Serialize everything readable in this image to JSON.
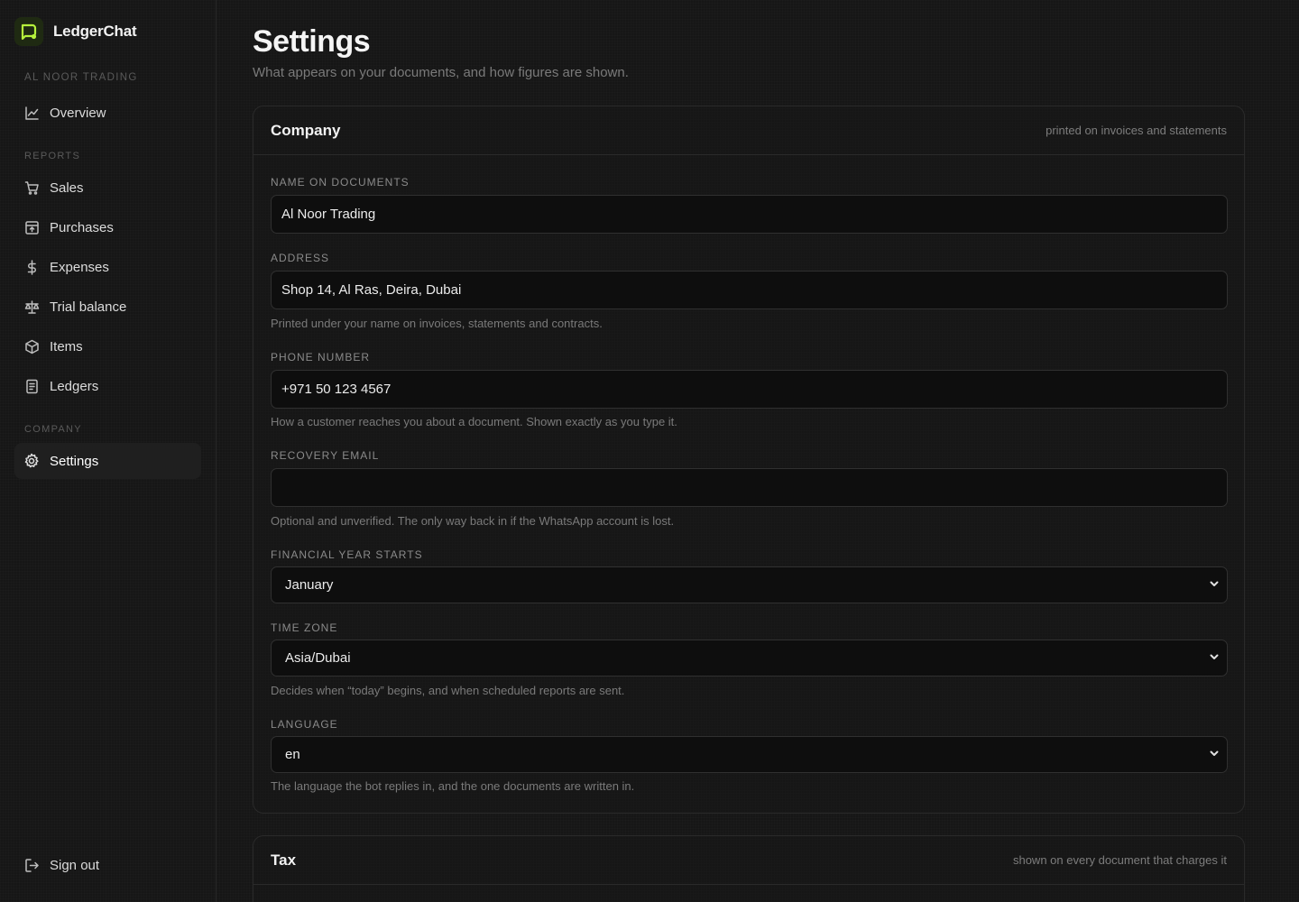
{
  "brand": {
    "name": "LedgerChat",
    "accent": "#b6f23c"
  },
  "sidebar": {
    "org_name": "AL NOOR TRADING",
    "overview": "Overview",
    "reports_label": "REPORTS",
    "reports": [
      {
        "label": "Sales",
        "icon": "cart-icon"
      },
      {
        "label": "Purchases",
        "icon": "inbox-icon"
      },
      {
        "label": "Expenses",
        "icon": "dollar-icon"
      },
      {
        "label": "Trial balance",
        "icon": "scale-icon"
      },
      {
        "label": "Items",
        "icon": "box-icon"
      },
      {
        "label": "Ledgers",
        "icon": "ledger-icon"
      }
    ],
    "company_label": "COMPANY",
    "settings": "Settings",
    "sign_out": "Sign out"
  },
  "page": {
    "title": "Settings",
    "subtitle": "What appears on your documents, and how figures are shown."
  },
  "company_card": {
    "title": "Company",
    "note": "printed on invoices and statements",
    "name_label": "NAME ON DOCUMENTS",
    "name_value": "Al Noor Trading",
    "address_label": "ADDRESS",
    "address_value": "Shop 14, Al Ras, Deira, Dubai",
    "address_help": "Printed under your name on invoices, statements and contracts.",
    "phone_label": "PHONE NUMBER",
    "phone_value": "+971 50 123 4567",
    "phone_help": "How a customer reaches you about a document. Shown exactly as you type it.",
    "email_label": "RECOVERY EMAIL",
    "email_value": "",
    "email_help": "Optional and unverified. The only way back in if the WhatsApp account is lost.",
    "fy_label": "FINANCIAL YEAR STARTS",
    "fy_value": "January",
    "tz_label": "TIME ZONE",
    "tz_value": "Asia/Dubai",
    "tz_help": "Decides when “today” begins, and when scheduled reports are sent.",
    "lang_label": "LANGUAGE",
    "lang_value": "en",
    "lang_help": "The language the bot replies in, and the one documents are written in."
  },
  "tax_card": {
    "title": "Tax",
    "note": "shown on every document that charges it"
  }
}
